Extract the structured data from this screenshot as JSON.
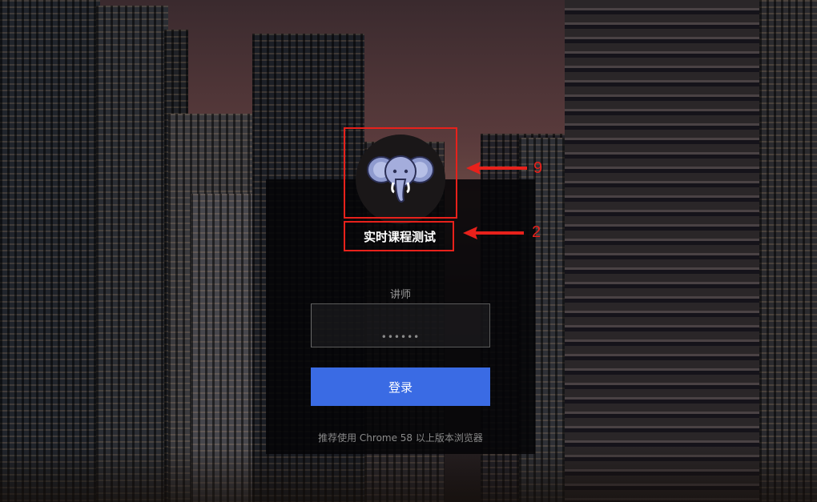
{
  "login": {
    "title": "实时课程测试",
    "role_label": "讲师",
    "password_placeholder": "••••••",
    "login_button": "登录",
    "browser_hint": "推荐使用 Chrome 58 以上版本浏览器"
  },
  "annotations": [
    {
      "number": "9"
    },
    {
      "number": "2"
    }
  ],
  "colors": {
    "button": "#3a6be4",
    "annotation": "#e8211b",
    "panel": "#050507"
  },
  "icons": {
    "avatar": "elephant-icon"
  }
}
